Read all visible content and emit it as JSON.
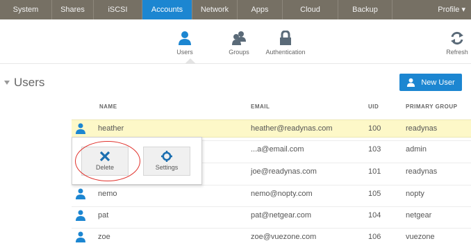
{
  "topnav": {
    "tabs": [
      "System",
      "Shares",
      "iSCSI",
      "Accounts",
      "Network",
      "Apps",
      "Cloud",
      "Backup"
    ],
    "active": "Accounts",
    "profile": "Profile ▾"
  },
  "subtabs": {
    "users": "Users",
    "groups": "Groups",
    "authentication": "Authentication",
    "refresh": "Refresh"
  },
  "section": {
    "title": "Users",
    "new_user": "New User"
  },
  "table": {
    "headers": {
      "name": "NAME",
      "email": "EMAIL",
      "uid": "UID",
      "group": "PRIMARY GROUP"
    },
    "rows": [
      {
        "name": "heather",
        "email": "heather@readynas.com",
        "uid": "100",
        "group": "readynas"
      },
      {
        "name": "",
        "email": "...a@email.com",
        "uid": "103",
        "group": "admin"
      },
      {
        "name": "",
        "email": "joe@readynas.com",
        "uid": "101",
        "group": "readynas"
      },
      {
        "name": "nemo",
        "email": "nemo@nopty.com",
        "uid": "105",
        "group": "nopty"
      },
      {
        "name": "pat",
        "email": "pat@netgear.com",
        "uid": "104",
        "group": "netgear"
      },
      {
        "name": "zoe",
        "email": "zoe@vuezone.com",
        "uid": "106",
        "group": "vuezone"
      }
    ]
  },
  "popup": {
    "delete": "Delete",
    "settings": "Settings"
  },
  "colors": {
    "nav_bg": "#767064",
    "accent": "#1c86d1",
    "selected_row": "#fdf8c8",
    "highlight_circle": "#e0302a"
  },
  "icons": {
    "user": "user-icon",
    "group": "group-icon",
    "lock": "lock-icon",
    "refresh": "refresh-icon",
    "delete": "x-icon",
    "settings": "gear-icon"
  }
}
